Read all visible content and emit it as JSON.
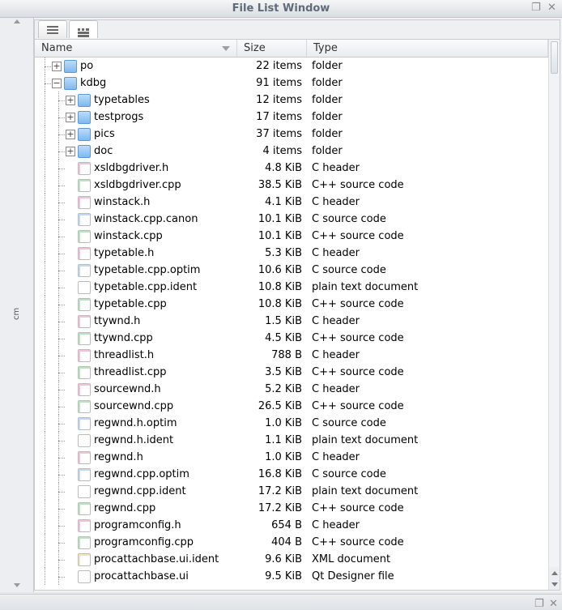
{
  "window": {
    "title": "File List Window"
  },
  "sidepanel": {
    "label": "cm"
  },
  "columns": {
    "name": "Name",
    "size": "Size",
    "type": "Type"
  },
  "tree": [
    {
      "depth": 0,
      "exp": "plus",
      "icon": "folder",
      "name": "po",
      "size": "22 items",
      "type": "folder"
    },
    {
      "depth": 0,
      "exp": "minus",
      "icon": "folder",
      "name": "kdbg",
      "size": "91 items",
      "type": "folder"
    },
    {
      "depth": 1,
      "exp": "plus",
      "icon": "folder",
      "name": "typetables",
      "size": "12 items",
      "type": "folder"
    },
    {
      "depth": 1,
      "exp": "plus",
      "icon": "folder",
      "name": "testprogs",
      "size": "17 items",
      "type": "folder"
    },
    {
      "depth": 1,
      "exp": "plus",
      "icon": "folder",
      "name": "pics",
      "size": "37 items",
      "type": "folder"
    },
    {
      "depth": 1,
      "exp": "plus",
      "icon": "folder",
      "name": "doc",
      "size": "4 items",
      "type": "folder"
    },
    {
      "depth": 1,
      "exp": "",
      "icon": "hfile",
      "name": "xsldbgdriver.h",
      "size": "4.8 KiB",
      "type": "C header"
    },
    {
      "depth": 1,
      "exp": "",
      "icon": "cppfile",
      "name": "xsldbgdriver.cpp",
      "size": "38.5 KiB",
      "type": "C++ source code"
    },
    {
      "depth": 1,
      "exp": "",
      "icon": "hfile",
      "name": "winstack.h",
      "size": "4.1 KiB",
      "type": "C header"
    },
    {
      "depth": 1,
      "exp": "",
      "icon": "cfile",
      "name": "winstack.cpp.canon",
      "size": "10.1 KiB",
      "type": "C source code"
    },
    {
      "depth": 1,
      "exp": "",
      "icon": "cppfile",
      "name": "winstack.cpp",
      "size": "10.1 KiB",
      "type": "C++ source code"
    },
    {
      "depth": 1,
      "exp": "",
      "icon": "hfile",
      "name": "typetable.h",
      "size": "5.3 KiB",
      "type": "C header"
    },
    {
      "depth": 1,
      "exp": "",
      "icon": "cfile",
      "name": "typetable.cpp.optim",
      "size": "10.6 KiB",
      "type": "C source code"
    },
    {
      "depth": 1,
      "exp": "",
      "icon": "txtfile",
      "name": "typetable.cpp.ident",
      "size": "10.8 KiB",
      "type": "plain text document"
    },
    {
      "depth": 1,
      "exp": "",
      "icon": "cppfile",
      "name": "typetable.cpp",
      "size": "10.8 KiB",
      "type": "C++ source code"
    },
    {
      "depth": 1,
      "exp": "",
      "icon": "hfile",
      "name": "ttywnd.h",
      "size": "1.5 KiB",
      "type": "C header"
    },
    {
      "depth": 1,
      "exp": "",
      "icon": "cppfile",
      "name": "ttywnd.cpp",
      "size": "4.5 KiB",
      "type": "C++ source code"
    },
    {
      "depth": 1,
      "exp": "",
      "icon": "hfile",
      "name": "threadlist.h",
      "size": "788 B",
      "type": "C header"
    },
    {
      "depth": 1,
      "exp": "",
      "icon": "cppfile",
      "name": "threadlist.cpp",
      "size": "3.5 KiB",
      "type": "C++ source code"
    },
    {
      "depth": 1,
      "exp": "",
      "icon": "hfile",
      "name": "sourcewnd.h",
      "size": "5.2 KiB",
      "type": "C header"
    },
    {
      "depth": 1,
      "exp": "",
      "icon": "cppfile",
      "name": "sourcewnd.cpp",
      "size": "26.5 KiB",
      "type": "C++ source code"
    },
    {
      "depth": 1,
      "exp": "",
      "icon": "cfile",
      "name": "regwnd.h.optim",
      "size": "1.0 KiB",
      "type": "C source code"
    },
    {
      "depth": 1,
      "exp": "",
      "icon": "txtfile",
      "name": "regwnd.h.ident",
      "size": "1.1 KiB",
      "type": "plain text document"
    },
    {
      "depth": 1,
      "exp": "",
      "icon": "hfile",
      "name": "regwnd.h",
      "size": "1.0 KiB",
      "type": "C header"
    },
    {
      "depth": 1,
      "exp": "",
      "icon": "cfile",
      "name": "regwnd.cpp.optim",
      "size": "16.8 KiB",
      "type": "C source code"
    },
    {
      "depth": 1,
      "exp": "",
      "icon": "txtfile",
      "name": "regwnd.cpp.ident",
      "size": "17.2 KiB",
      "type": "plain text document"
    },
    {
      "depth": 1,
      "exp": "",
      "icon": "cppfile",
      "name": "regwnd.cpp",
      "size": "17.2 KiB",
      "type": "C++ source code"
    },
    {
      "depth": 1,
      "exp": "",
      "icon": "hfile",
      "name": "programconfig.h",
      "size": "654 B",
      "type": "C header"
    },
    {
      "depth": 1,
      "exp": "",
      "icon": "cppfile",
      "name": "programconfig.cpp",
      "size": "404 B",
      "type": "C++ source code"
    },
    {
      "depth": 1,
      "exp": "",
      "icon": "xmlfile",
      "name": "procattachbase.ui.ident",
      "size": "9.6 KiB",
      "type": "XML document"
    },
    {
      "depth": 1,
      "exp": "",
      "icon": "txtfile",
      "name": "procattachbase.ui",
      "size": "9.5 KiB",
      "type": "Qt Designer file"
    }
  ]
}
